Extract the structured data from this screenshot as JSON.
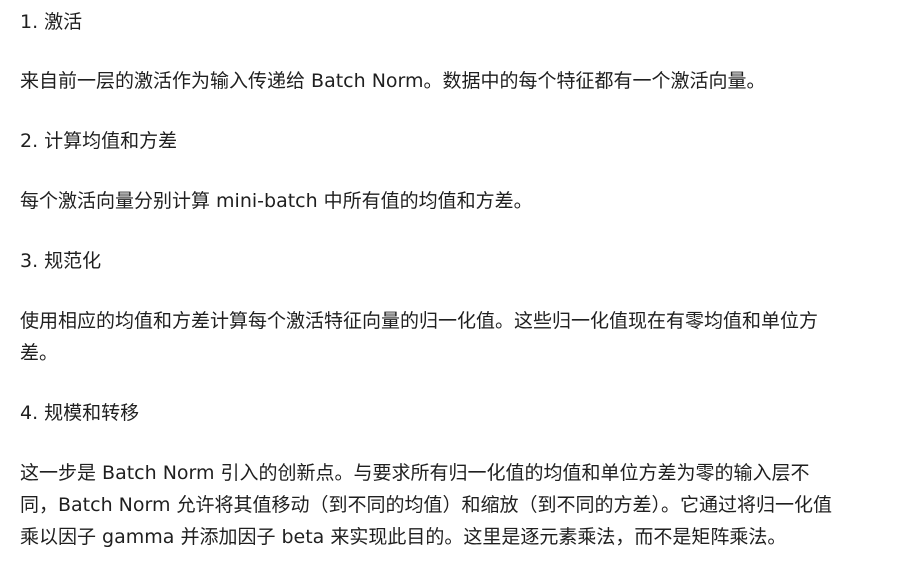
{
  "sections": [
    {
      "heading": "1. 激活",
      "body": "来自前一层的激活作为输入传递给 Batch Norm。数据中的每个特征都有一个激活向量。"
    },
    {
      "heading": "2. 计算均值和方差",
      "body": "每个激活向量分别计算 mini-batch 中所有值的均值和方差。"
    },
    {
      "heading": "3. 规范化",
      "body_lines": [
        "使用相应的均值和方差计算每个激活特征向量的归一化值。这些归一化值现在有零均值和单位方",
        "差。"
      ]
    },
    {
      "heading": "4. 规模和转移",
      "body_lines": [
        "这一步是 Batch Norm 引入的创新点。与要求所有归一化值的均值和单位方差为零的输入层不",
        "同，Batch Norm 允许将其值移动（到不同的均值）和缩放（到不同的方差）。它通过将归一化值",
        "乘以因子 gamma 并添加因子 beta 来实现此目的。这里是逐元素乘法，而不是矩阵乘法。"
      ]
    }
  ]
}
